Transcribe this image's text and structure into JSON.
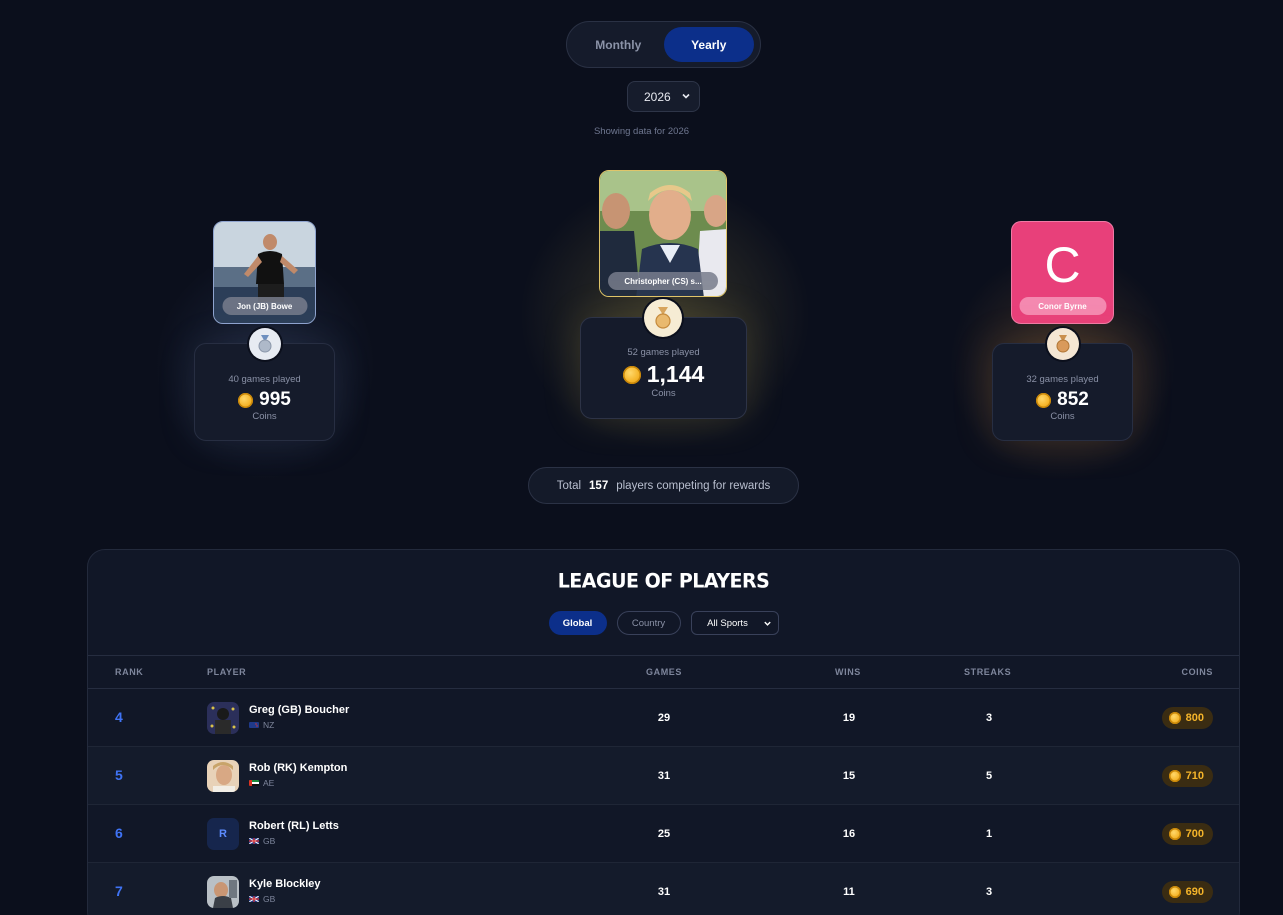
{
  "period_toggle": {
    "monthly_label": "Monthly",
    "yearly_label": "Yearly",
    "selected": "Yearly"
  },
  "year_select": {
    "value": "2026"
  },
  "showing_text": "Showing data for 2026",
  "podium": {
    "first": {
      "name": "Christopher (CS) s...",
      "games": "52 games played",
      "coins": "1,144",
      "coins_label": "Coins",
      "medal": "gold-medal"
    },
    "second": {
      "name": "Jon (JB) Bowe",
      "games": "40 games played",
      "coins": "995",
      "coins_label": "Coins",
      "medal": "silver-medal"
    },
    "third": {
      "name": "Conor Byrne",
      "initial": "C",
      "games": "32 games played",
      "coins": "852",
      "coins_label": "Coins",
      "medal": "bronze-medal"
    }
  },
  "total": {
    "prefix": "Total",
    "count": "157",
    "suffix": "players competing for rewards"
  },
  "league": {
    "title": "LEAGUE OF PLAYERS",
    "filters": {
      "global": "Global",
      "country": "Country",
      "sports": "All Sports"
    },
    "columns": {
      "rank": "RANK",
      "player": "PLAYER",
      "games": "GAMES",
      "wins": "WINS",
      "streaks": "STREAKS",
      "coins": "COINS"
    },
    "rows": [
      {
        "rank": "4",
        "name": "Greg (GB) Boucher",
        "country": "NZ",
        "games": "29",
        "wins": "19",
        "streaks": "3",
        "coins": "800"
      },
      {
        "rank": "5",
        "name": "Rob (RK) Kempton",
        "country": "AE",
        "games": "31",
        "wins": "15",
        "streaks": "5",
        "coins": "710"
      },
      {
        "rank": "6",
        "name": "Robert (RL) Letts",
        "initial": "R",
        "country": "GB",
        "games": "25",
        "wins": "16",
        "streaks": "1",
        "coins": "700"
      },
      {
        "rank": "7",
        "name": "Kyle Blockley",
        "country": "GB",
        "games": "31",
        "wins": "11",
        "streaks": "3",
        "coins": "690"
      }
    ]
  },
  "colors": {
    "accent": "#0c2f8a",
    "rank": "#3f73f5",
    "coin": "#f5b52a",
    "pink": "#e8407a"
  }
}
